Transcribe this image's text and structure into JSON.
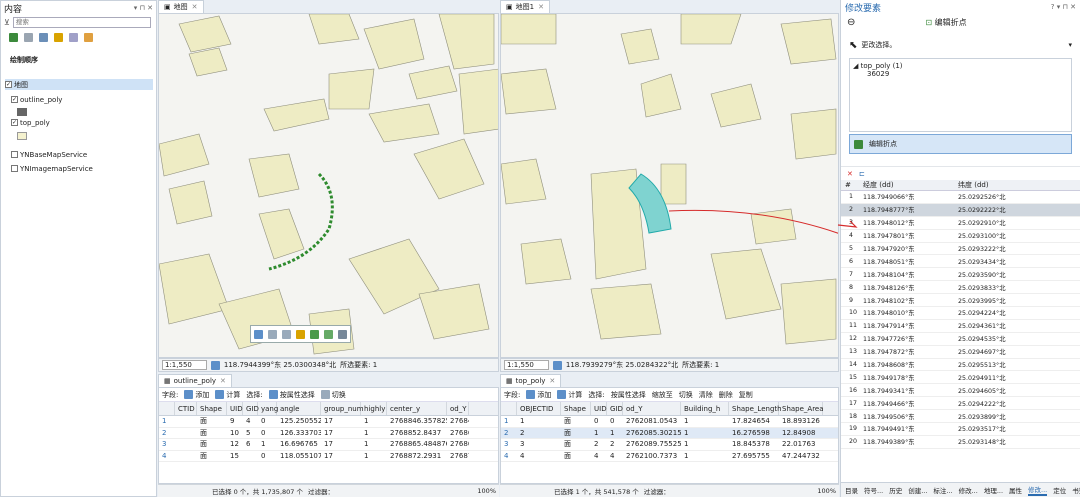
{
  "contents": {
    "title": "内容",
    "search_placeholder": "搜索",
    "drawing_order": "绘制顺序",
    "layers": [
      {
        "name": "地图",
        "checked": true,
        "level": 0
      },
      {
        "name": "outline_poly",
        "checked": true,
        "level": 1
      },
      {
        "name": "top_poly",
        "checked": true,
        "level": 1
      },
      {
        "name": "YNBaseMapService",
        "checked": false,
        "level": 1
      },
      {
        "name": "YNImagemapService",
        "checked": false,
        "level": 1
      }
    ]
  },
  "map1": {
    "tab": "地图",
    "scale": "1:1,550",
    "coords": "118.7944399°东 25.0300348°北",
    "selected_label": "所选要素: 1"
  },
  "map2": {
    "tab": "地图1",
    "scale": "1:1,550",
    "coords": "118.7939279°东 25.0284322°北",
    "selected_label": "所选要素: 1"
  },
  "table1": {
    "tab": "outline_poly",
    "toolbar": {
      "field": "字段:",
      "add": "添加",
      "calc": "计算",
      "select": "选择:",
      "by_attr": "按属性选择",
      "switch": "切换"
    },
    "columns": [
      "CTID",
      "Shape",
      "UID",
      "GID",
      "yang",
      "angle",
      "group_num",
      "highly",
      "center_y",
      "od_Y"
    ],
    "rows": [
      [
        "",
        "面",
        "9",
        "4",
        "0",
        "125.250552",
        "17",
        "1",
        "2768846.357825",
        "27684"
      ],
      [
        "",
        "面",
        "10",
        "5",
        "0",
        "126.333703",
        "17",
        "1",
        "2768852.8437",
        "27686"
      ],
      [
        "",
        "面",
        "12",
        "6",
        "1",
        "16.696765",
        "17",
        "1",
        "2768865.484876",
        "27686"
      ],
      [
        "",
        "面",
        "15",
        "",
        "0",
        "118.055107",
        "17",
        "1",
        "2768872.2931",
        "27687"
      ]
    ],
    "status": "已选择 0 个，共 1,735,807 个",
    "filter": "过滤器：",
    "zoom": "100%"
  },
  "table2": {
    "tab": "top_poly",
    "toolbar": {
      "field": "字段:",
      "add": "添加",
      "calc": "计算",
      "select": "选择:",
      "by_attr": "按属性选择",
      "zoom": "缩放至",
      "switch": "切换",
      "clear": "清除",
      "delete": "删除",
      "copy": "复制"
    },
    "columns": [
      "OBJECTID",
      "Shape",
      "UID",
      "GID",
      "od_Y",
      "Building_h",
      "Shape_Length",
      "Shape_Area"
    ],
    "rows": [
      [
        "1",
        "面",
        "0",
        "0",
        "2762081.0543",
        "1",
        "17.824654",
        "18.893126"
      ],
      [
        "2",
        "面",
        "1",
        "1",
        "2762085.30215",
        "1",
        "16.276598",
        "12.84908"
      ],
      [
        "3",
        "面",
        "2",
        "2",
        "2762089.75525",
        "1",
        "18.845378",
        "22.01763"
      ],
      [
        "4",
        "面",
        "4",
        "4",
        "2762100.7373",
        "1",
        "27.695755",
        "47.244732"
      ]
    ],
    "status": "已选择 1 个，共 541,578 个",
    "filter": "过滤器：",
    "zoom": "100%"
  },
  "modify": {
    "title": "修改要素",
    "help": "?",
    "heading": "编辑折点",
    "change_selection": "更改选择。",
    "layer": "top_poly (1)",
    "feature_id": "36029",
    "edit_vertex": "编辑折点",
    "columns": [
      "#",
      "经度 (dd)",
      "纬度 (dd)"
    ],
    "vertices": [
      [
        "1",
        "118.7949066°东",
        "25.0292526°北"
      ],
      [
        "2",
        "118.7948777°东",
        "25.0292222°北"
      ],
      [
        "3",
        "118.7948012°东",
        "25.0292910°北"
      ],
      [
        "4",
        "118.7947801°东",
        "25.0293100°北"
      ],
      [
        "5",
        "118.7947920°东",
        "25.0293222°北"
      ],
      [
        "6",
        "118.7948051°东",
        "25.0293434°北"
      ],
      [
        "7",
        "118.7948104°东",
        "25.0293590°北"
      ],
      [
        "8",
        "118.7948126°东",
        "25.0293833°北"
      ],
      [
        "9",
        "118.7948102°东",
        "25.0293995°北"
      ],
      [
        "10",
        "118.7948010°东",
        "25.0294224°北"
      ],
      [
        "11",
        "118.7947914°东",
        "25.0294361°北"
      ],
      [
        "12",
        "118.7947726°东",
        "25.0294535°北"
      ],
      [
        "13",
        "118.7947872°东",
        "25.0294697°北"
      ],
      [
        "14",
        "118.7948608°东",
        "25.0295513°北"
      ],
      [
        "15",
        "118.7949178°东",
        "25.0294911°北"
      ],
      [
        "16",
        "118.7949341°东",
        "25.0294605°北"
      ],
      [
        "17",
        "118.7949466°东",
        "25.0294222°北"
      ],
      [
        "18",
        "118.7949506°东",
        "25.0293899°北"
      ],
      [
        "19",
        "118.7949491°东",
        "25.0293517°北"
      ],
      [
        "20",
        "118.7949389°东",
        "25.0293148°北"
      ]
    ],
    "bottom_tabs": [
      "目录",
      "符号...",
      "历史",
      "创建...",
      "标注...",
      "修改...",
      "地理...",
      "属性",
      "修改...",
      "定位",
      "书签"
    ]
  },
  "colors": {
    "building": "#eeecc4",
    "shadow": "#a9a99a",
    "accent": "#2b6cb0",
    "selected": "#7fd3d0",
    "red": "#d62b2b"
  }
}
